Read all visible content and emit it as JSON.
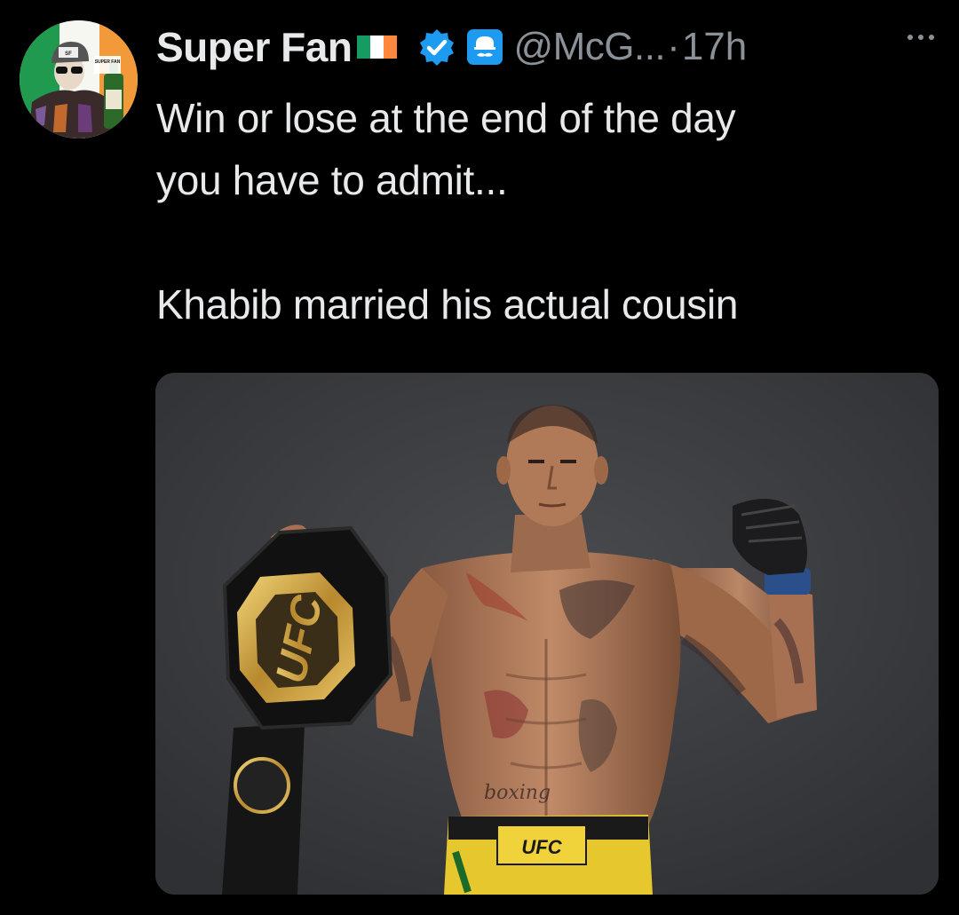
{
  "tweet": {
    "display_name": "Super Fan",
    "flag": "ireland-flag-icon",
    "handle": "@McG...",
    "dot": "·",
    "timestamp": "17h",
    "text_lines": [
      "Win or lose at the end of the day",
      "you have to admit...",
      "",
      "Khabib married his actual cousin"
    ],
    "belt_text": "UFC",
    "shorts_text": "UFC",
    "tattoo_text": "boxing",
    "avatar_badge_text": "SUPER FAN"
  },
  "icons": {
    "verified": "verified-badge-icon",
    "affiliate": "affiliate-badge-icon",
    "more": "more-options-icon"
  },
  "colors": {
    "background": "#000000",
    "text_primary": "#e7e9ea",
    "text_secondary": "#8b9198",
    "verified_blue": "#1d9bf0",
    "flag_green": "#169b62",
    "flag_white": "#ffffff",
    "flag_orange": "#ff883e"
  }
}
